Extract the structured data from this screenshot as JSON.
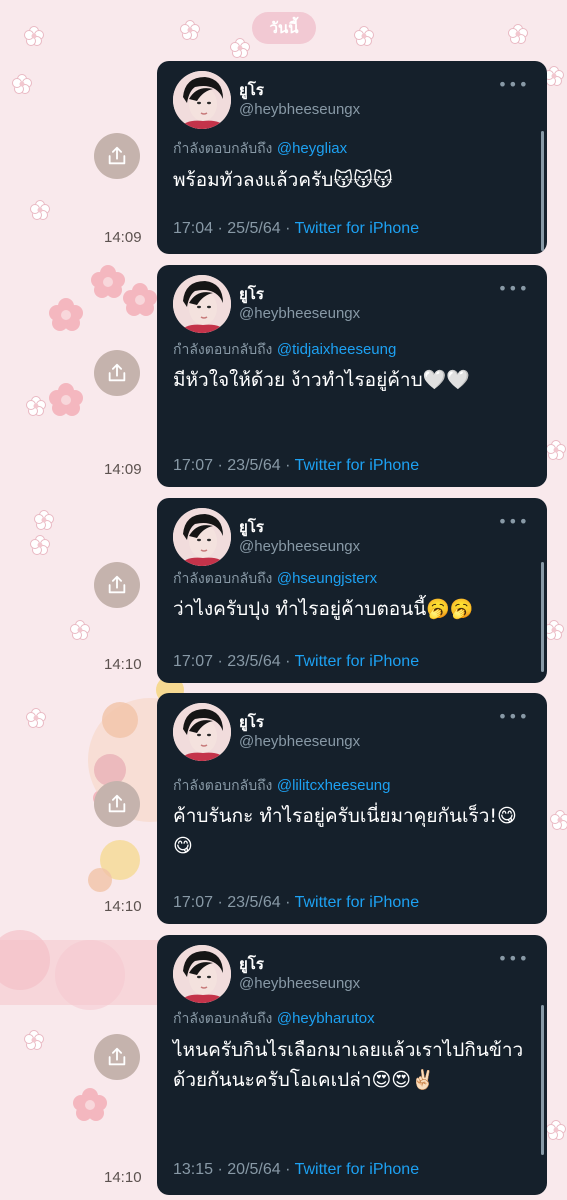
{
  "date_divider": "วันนี้",
  "messages": [
    {
      "time": "14:09",
      "tweet": {
        "display_name": "ยูโร",
        "handle": "@heybheeseungx",
        "reply_prefix": "กำลังตอบกลับถึง",
        "reply_to": "@heygliax",
        "text": "พร้อมทัวลงแล้วครับ😽😽😽",
        "time": "17:04",
        "date": "25/5/64",
        "client": "Twitter for iPhone"
      }
    },
    {
      "time": "14:09",
      "tweet": {
        "display_name": "ยูโร",
        "handle": "@heybheeseungx",
        "reply_prefix": "กำลังตอบกลับถึง",
        "reply_to": "@tidjaixheeseung",
        "text": "มีหัวใจให้ด้วย ง้าวทำไรอยู่ค้าบ🤍🤍",
        "time": "17:07",
        "date": "23/5/64",
        "client": "Twitter for iPhone"
      }
    },
    {
      "time": "14:10",
      "tweet": {
        "display_name": "ยูโร",
        "handle": "@heybheeseungx",
        "reply_prefix": "กำลังตอบกลับถึง",
        "reply_to": "@hseungjsterx",
        "text": "ว่าไงครับปุง ทำไรอยู่ค้าบตอนนี้🥱🥱",
        "time": "17:07",
        "date": "23/5/64",
        "client": "Twitter for iPhone"
      }
    },
    {
      "time": "14:10",
      "tweet": {
        "display_name": "ยูโร",
        "handle": "@heybheeseungx",
        "reply_prefix": "กำลังตอบกลับถึง",
        "reply_to": "@lilitcxheeseung",
        "text": "ค้าบรันกะ ทำไรอยู่ครับเนี่ยมาคุยกันเร็ว!😋😋",
        "time": "17:07",
        "date": "23/5/64",
        "client": "Twitter for iPhone"
      }
    },
    {
      "time": "14:10",
      "tweet": {
        "display_name": "ยูโร",
        "handle": "@heybheeseungx",
        "reply_prefix": "กำลังตอบกลับถึง",
        "reply_to": "@heybharutox",
        "text": "ไหนครับกินไรเลือกมาเลยแล้วเราไปกินข้าวด้วยกันนะครับโอเคเปล่า😍😍✌🏻",
        "time": "13:15",
        "date": "20/5/64",
        "client": "Twitter for iPhone"
      }
    }
  ],
  "colors": {
    "background": "#f9e9ec",
    "card": "#15202b",
    "muted": "#8899a6",
    "link": "#1da1f2",
    "share_button": "#c5b3ad",
    "date_pill": "#f2c9d3"
  },
  "icons": {
    "share": "share-icon",
    "more": "more-icon",
    "avatar": "avatar"
  }
}
